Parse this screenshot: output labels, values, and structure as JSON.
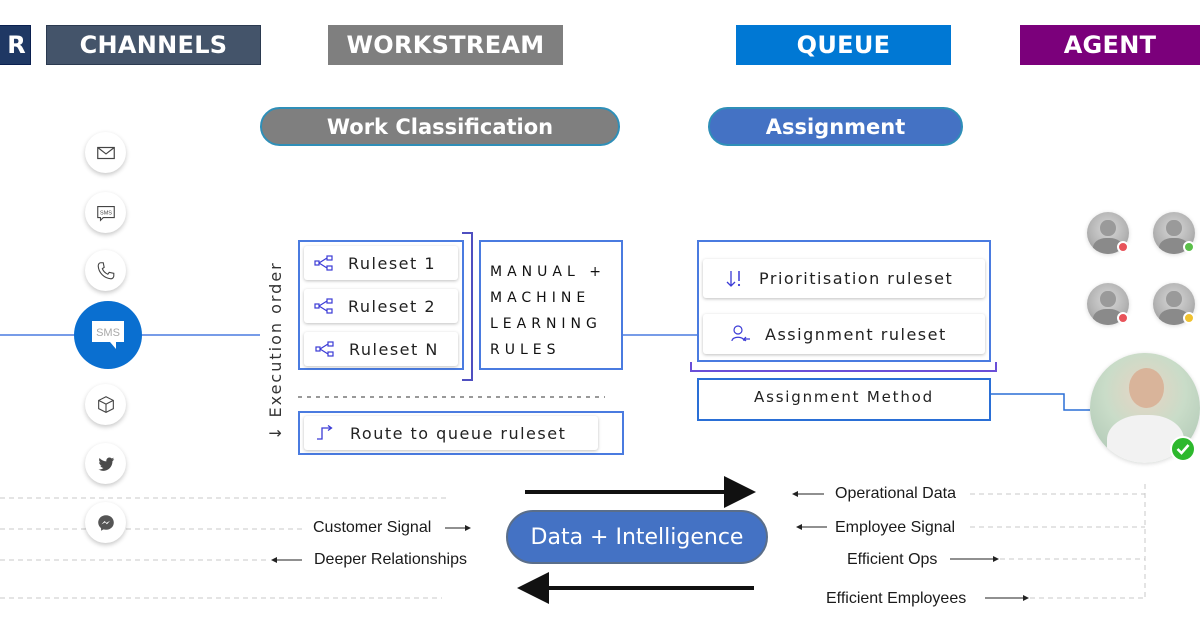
{
  "headers": {
    "prev_partial": "R",
    "channels": "CHANNELS",
    "workstream": "WORKSTREAM",
    "queue": "QUEUE",
    "agent": "AGENT"
  },
  "pills": {
    "work_classification": "Work Classification",
    "assignment": "Assignment"
  },
  "channels": [
    {
      "icon": "email-icon"
    },
    {
      "icon": "sms-icon",
      "text": "SMS"
    },
    {
      "icon": "phone-icon"
    },
    {
      "icon": "sms-icon",
      "text": "SMS",
      "active": true
    },
    {
      "icon": "package-icon"
    },
    {
      "icon": "twitter-icon"
    },
    {
      "icon": "messenger-icon"
    }
  ],
  "classification": {
    "execution_order_label": "Execution order",
    "execution_arrow": "↓",
    "rulesets": [
      "Ruleset 1",
      "Ruleset 2",
      "Ruleset N"
    ],
    "ml_rules": [
      "MANUAL +",
      "MACHINE",
      "LEARNING",
      "RULES"
    ],
    "route_ruleset": "Route to queue ruleset"
  },
  "assignment": {
    "prioritisation": "Prioritisation ruleset",
    "assignment_ruleset": "Assignment ruleset",
    "method": "Assignment Method"
  },
  "agents": [
    {
      "status": "busy",
      "color": "#e8535a"
    },
    {
      "status": "available",
      "color": "#5bbf4a"
    },
    {
      "status": "busy",
      "color": "#e8535a"
    },
    {
      "status": "away",
      "color": "#f0c230"
    },
    {
      "status": "available-selected",
      "color": "#2db82d"
    }
  ],
  "signals": {
    "customer_signal": "Customer Signal",
    "deeper_relationships": "Deeper Relationships",
    "data_intelligence": "Data + Intelligence",
    "operational_data": "Operational Data",
    "employee_signal": "Employee Signal",
    "efficient_ops": "Efficient Ops",
    "efficient_employees": "Efficient Employees"
  },
  "colors": {
    "channels": "#44546a",
    "workstream": "#7f7f7f",
    "queue": "#0078d4",
    "agent": "#7b007b",
    "accent_blue": "#4472c4",
    "line_blue": "#4a7be0"
  }
}
